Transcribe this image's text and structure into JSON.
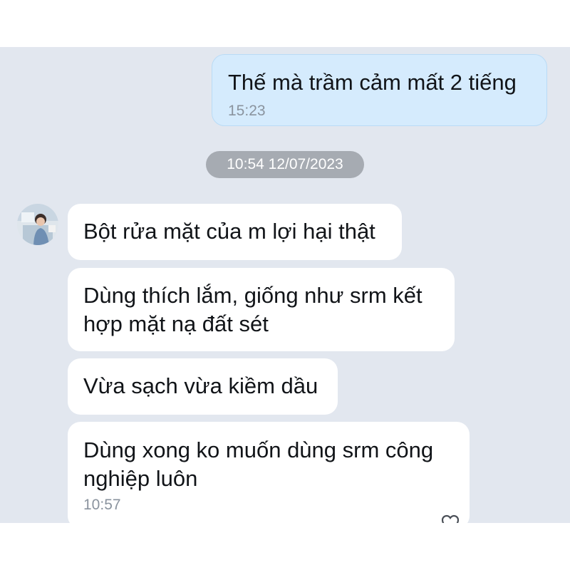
{
  "messages": {
    "sent_1": {
      "text": "Thế mà trầm cảm mất 2 tiếng",
      "time": "15:23"
    },
    "date_separator": "10:54 12/07/2023",
    "recv_1": {
      "text": "Bột rửa mặt của m lợi hại thật"
    },
    "recv_2": {
      "text": "Dùng thích lắm, giống như srm kết\nhợp mặt nạ đất sét"
    },
    "recv_3": {
      "text": "Vừa sạch vừa kiềm dầu"
    },
    "recv_4": {
      "text": "Dùng xong ko muốn dùng srm công\nnghiệp luôn",
      "time": "10:57"
    }
  },
  "icons": {
    "avatar": "avatar",
    "reaction": "heart-reaction-icon"
  },
  "colors": {
    "chat_background": "#e2e7ef",
    "sent_bubble": "#d5ebfd",
    "received_bubble": "#ffffff",
    "date_pill": "#a6abb2",
    "timestamp": "#8a939e"
  }
}
